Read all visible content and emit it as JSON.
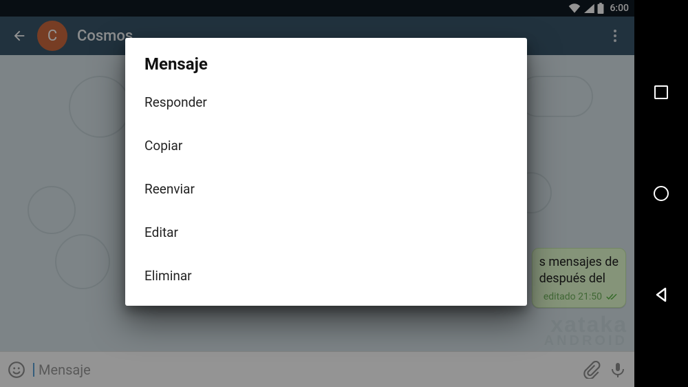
{
  "statusbar": {
    "time": "6:00"
  },
  "appbar": {
    "avatar_letter": "C",
    "title": "Cosmos"
  },
  "message_bubble": {
    "line1": "s mensajes de",
    "line2": "después del",
    "edited_label": "editado 21:50"
  },
  "inputbar": {
    "placeholder": "Mensaje"
  },
  "dialog": {
    "title": "Mensaje",
    "items": [
      "Responder",
      "Copiar",
      "Reenviar",
      "Editar",
      "Eliminar"
    ]
  },
  "watermark": {
    "line1": "xataka",
    "line2": "ANDROID"
  }
}
